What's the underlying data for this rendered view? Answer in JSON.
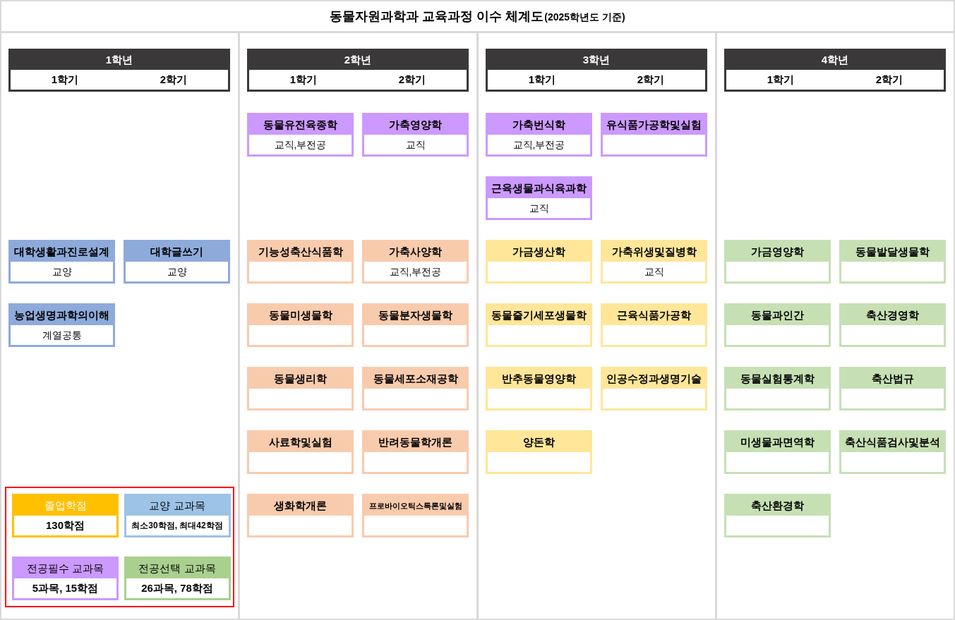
{
  "title": "동물자원과학과 교육과정 이수 체계도",
  "subtitle": "(2025학년도 기준)",
  "years": [
    {
      "label": "1학년",
      "semesters": [
        "1학기",
        "2학기"
      ],
      "rows": [
        [
          null,
          null
        ],
        [
          null,
          null
        ],
        [
          {
            "name": "대학생활과진로설계",
            "note": "교양",
            "color": "#8eaadb"
          },
          {
            "name": "대학글쓰기",
            "note": "교양",
            "color": "#8eaadb"
          }
        ],
        [
          {
            "name": "농업생명과학의이해",
            "note": "계열공통",
            "color": "#8eaadb"
          },
          null
        ]
      ]
    },
    {
      "label": "2학년",
      "semesters": [
        "1학기",
        "2학기"
      ],
      "rows": [
        [
          {
            "name": "동물유전육종학",
            "note": "교직,부전공",
            "color": "#cc99ff"
          },
          {
            "name": "가축영양학",
            "note": "교직",
            "color": "#cc99ff"
          }
        ],
        [
          null,
          null
        ],
        [
          {
            "name": "기능성축산식품학",
            "color": "#f8cbad"
          },
          {
            "name": "가축사양학",
            "note": "교직,부전공",
            "color": "#f8cbad"
          }
        ],
        [
          {
            "name": "동물미생물학",
            "color": "#f8cbad"
          },
          {
            "name": "동물분자생물학",
            "color": "#f8cbad"
          }
        ],
        [
          {
            "name": "동물생리학",
            "color": "#f8cbad"
          },
          {
            "name": "동물세포소재공학",
            "color": "#f8cbad"
          }
        ],
        [
          {
            "name": "사료학및실험",
            "color": "#f8cbad"
          },
          {
            "name": "반려동물학개론",
            "color": "#f8cbad"
          }
        ],
        [
          {
            "name": "생화학개론",
            "color": "#f8cbad"
          },
          {
            "name": "프로바이오틱스특론및실험",
            "color": "#f8cbad"
          }
        ]
      ]
    },
    {
      "label": "3학년",
      "semesters": [
        "1학기",
        "2학기"
      ],
      "rows": [
        [
          {
            "name": "가축번식학",
            "note": "교직,부전공",
            "color": "#cc99ff"
          },
          {
            "name": "유식품가공학및실험",
            "color": "#cc99ff"
          }
        ],
        [
          {
            "name": "근육생물과식육과학",
            "note": "교직",
            "color": "#cc99ff"
          },
          null
        ],
        [
          {
            "name": "가금생산학",
            "color": "#ffe699"
          },
          {
            "name": "가축위생및질병학",
            "note": "교직",
            "color": "#ffe699"
          }
        ],
        [
          {
            "name": "동물줄기세포생물학",
            "color": "#ffe699"
          },
          {
            "name": "근육식품가공학",
            "color": "#ffe699"
          }
        ],
        [
          {
            "name": "반추동물영양학",
            "color": "#ffe699"
          },
          {
            "name": "인공수정과생명기술",
            "color": "#ffe699"
          }
        ],
        [
          {
            "name": "양돈학",
            "color": "#ffe699"
          },
          null
        ]
      ]
    },
    {
      "label": "4학년",
      "semesters": [
        "1학기",
        "2학기"
      ],
      "rows": [
        [
          null,
          null
        ],
        [
          null,
          null
        ],
        [
          {
            "name": "가금영양학",
            "color": "#c6e0b4"
          },
          {
            "name": "동물발달생물학",
            "color": "#c6e0b4"
          }
        ],
        [
          {
            "name": "동물과인간",
            "color": "#c6e0b4"
          },
          {
            "name": "축산경영학",
            "color": "#c6e0b4"
          }
        ],
        [
          {
            "name": "동물실험통계학",
            "color": "#c6e0b4"
          },
          {
            "name": "축산법규",
            "color": "#c6e0b4"
          }
        ],
        [
          {
            "name": "미생물과면역학",
            "color": "#c6e0b4"
          },
          {
            "name": "축산식품검사및분석",
            "color": "#c6e0b4"
          }
        ],
        [
          {
            "name": "축산환경학",
            "color": "#c6e0b4"
          },
          null
        ]
      ]
    }
  ],
  "legend": [
    {
      "title": "졸업학점",
      "value": "130학점",
      "color": "#ffc000",
      "title_inverted": true
    },
    {
      "title": "교양 교과목",
      "value": "최소30학점, 최대42학점",
      "color": "#9dc3e6",
      "title_inverted": false
    },
    {
      "title": "전공필수 교과목",
      "value": "5과목, 15학점",
      "color": "#cc99ff",
      "title_inverted": false
    },
    {
      "title": "전공선택 교과목",
      "value": "26과목, 78학점",
      "color": "#a9d08e",
      "title_inverted": false
    }
  ]
}
